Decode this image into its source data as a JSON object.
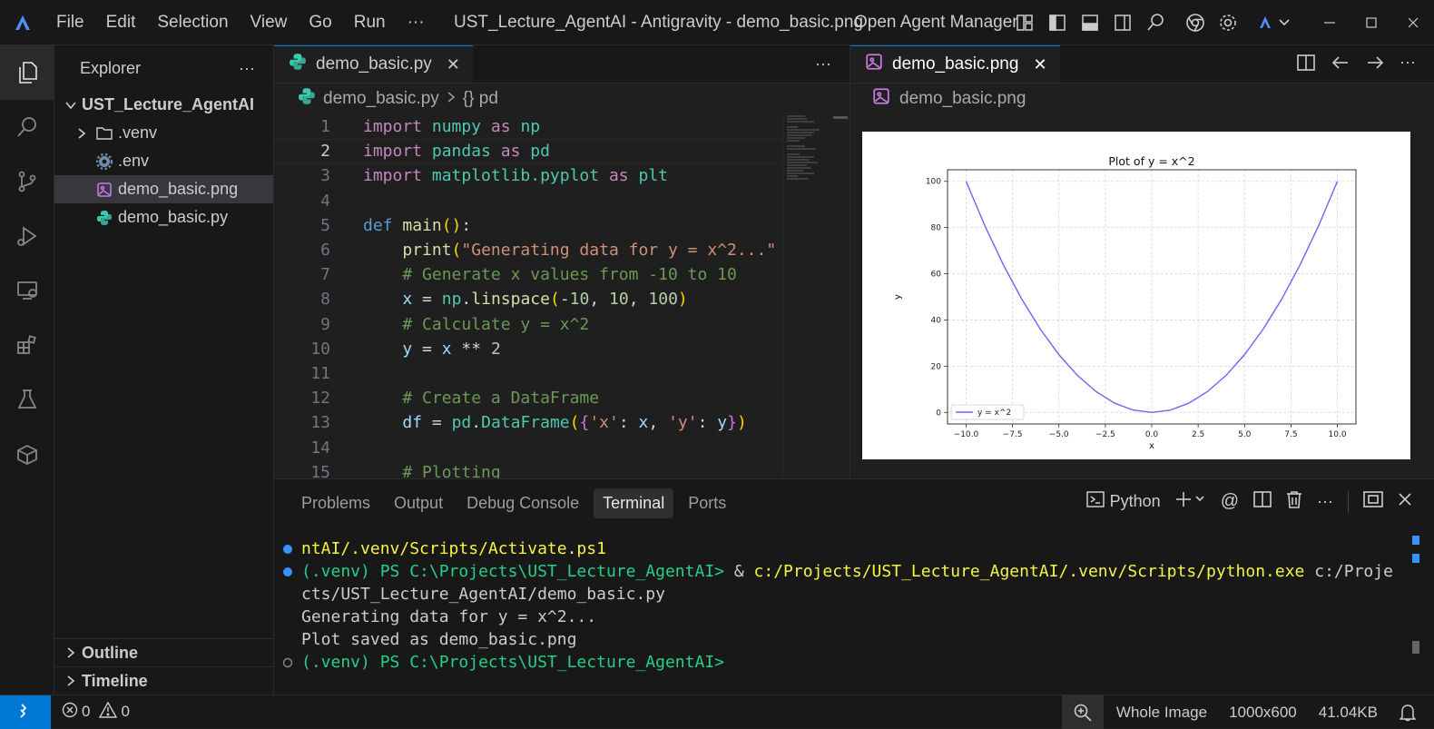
{
  "titlebar": {
    "menu": [
      "File",
      "Edit",
      "Selection",
      "View",
      "Go",
      "Run",
      "···"
    ],
    "window_title": "UST_Lecture_AgentAI - Antigravity - demo_basic.png",
    "agent_manager": "Open Agent Manager"
  },
  "sidebar": {
    "title": "Explorer",
    "more": "···",
    "root": "UST_Lecture_AgentAI",
    "items": [
      {
        "label": ".venv",
        "icon": "folder-icon"
      },
      {
        "label": ".env",
        "icon": "gear-icon"
      },
      {
        "label": "demo_basic.png",
        "icon": "image-file-icon",
        "selected": true
      },
      {
        "label": "demo_basic.py",
        "icon": "python-file-icon"
      }
    ],
    "outline": "Outline",
    "timeline": "Timeline"
  },
  "editor": {
    "tab_label": "demo_basic.py",
    "more": "···",
    "breadcrumb_file": "demo_basic.py",
    "breadcrumb_symbol": "{} pd",
    "line_numbers": [
      "1",
      "2",
      "3",
      "4",
      "5",
      "6",
      "7",
      "8",
      "9",
      "10",
      "11",
      "12",
      "13",
      "14",
      "15"
    ],
    "current_line": 2
  },
  "preview": {
    "tab_label": "demo_basic.png",
    "breadcrumb": "demo_basic.png"
  },
  "chart_data": {
    "type": "line",
    "title": "Plot of y = x^2",
    "xlabel": "x",
    "ylabel": "y",
    "xlim": [
      -11.0,
      11.0
    ],
    "ylim": [
      -5,
      105
    ],
    "xticks": [
      "-10.0",
      "-7.5",
      "-5.0",
      "-2.5",
      "0.0",
      "2.5",
      "5.0",
      "7.5",
      "10.0"
    ],
    "yticks": [
      "0",
      "20",
      "40",
      "60",
      "80",
      "100"
    ],
    "grid": true,
    "legend": "bottom-left",
    "series": [
      {
        "name": "y = x^2",
        "color": "#6666ff",
        "x": [
          -10,
          -9,
          -8,
          -7,
          -6,
          -5,
          -4,
          -3,
          -2,
          -1,
          0,
          1,
          2,
          3,
          4,
          5,
          6,
          7,
          8,
          9,
          10
        ],
        "y": [
          100,
          81,
          64,
          49,
          36,
          25,
          16,
          9,
          4,
          1,
          0,
          1,
          4,
          9,
          16,
          25,
          36,
          49,
          64,
          81,
          100
        ]
      }
    ]
  },
  "panel": {
    "tabs": [
      "Problems",
      "Output",
      "Debug Console",
      "Terminal",
      "Ports"
    ],
    "active_tab": "Terminal",
    "shell": "Python",
    "terminal": {
      "line1": "ntAI/.venv/Scripts/Activate.ps1",
      "line2_prompt": "(.venv) PS C:\\Projects\\UST_Lecture_AgentAI> ",
      "line2_amp": "& ",
      "line2_cmd": "c:/Projects/UST_Lecture_AgentAI/.venv/Scripts/python.exe",
      "line2_arg": " c:/Proje",
      "line3": "cts/UST_Lecture_AgentAI/demo_basic.py",
      "line4": "Generating data for y = x^2...",
      "line5": "Plot saved as demo_basic.png",
      "line6": "(.venv) PS C:\\Projects\\UST_Lecture_AgentAI>"
    }
  },
  "status": {
    "errors": "0",
    "warnings": "0",
    "zoom_label": "Whole Image",
    "dimensions": "1000x600",
    "filesize": "41.04KB"
  },
  "colors": {
    "accent": "#0078d4",
    "series": "#6666ff"
  }
}
